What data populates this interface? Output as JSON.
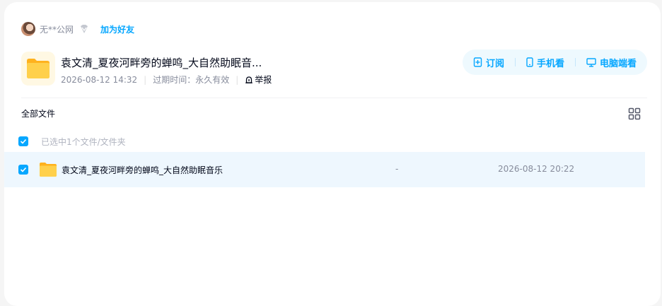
{
  "sharer": {
    "name": "无**公网",
    "add_friend_label": "加为好友"
  },
  "share": {
    "title": "袁文清_夏夜河畔旁的蝉鸣_大自然助眠音...",
    "created": "2026-08-12 14:32",
    "expire_label": "过期时间：",
    "expire_value": "永久有效",
    "report_label": "举报"
  },
  "actions": {
    "subscribe_label": "订阅",
    "phone_label": "手机看",
    "pc_label": "电脑端看"
  },
  "breadcrumb": "全部文件",
  "selection": {
    "text": "已选中1个文件/文件夹"
  },
  "files": [
    {
      "name": "袁文清_夏夜河畔旁的蝉鸣_大自然助眠音乐",
      "size": "-",
      "time": "2026-08-12 20:22",
      "selected": true
    }
  ],
  "icons": {
    "vip": "diamond-icon",
    "report": "alarm-bell-icon",
    "subscribe": "bookmark-plus-icon",
    "phone": "phone-icon",
    "pc": "monitor-icon",
    "grid": "grid-view-icon",
    "folder": "folder-icon",
    "check": "checkbox-checked-icon"
  },
  "colors": {
    "accent": "#06a7ff",
    "folder": "#ffc83d",
    "row_highlight": "#eef7fe"
  }
}
